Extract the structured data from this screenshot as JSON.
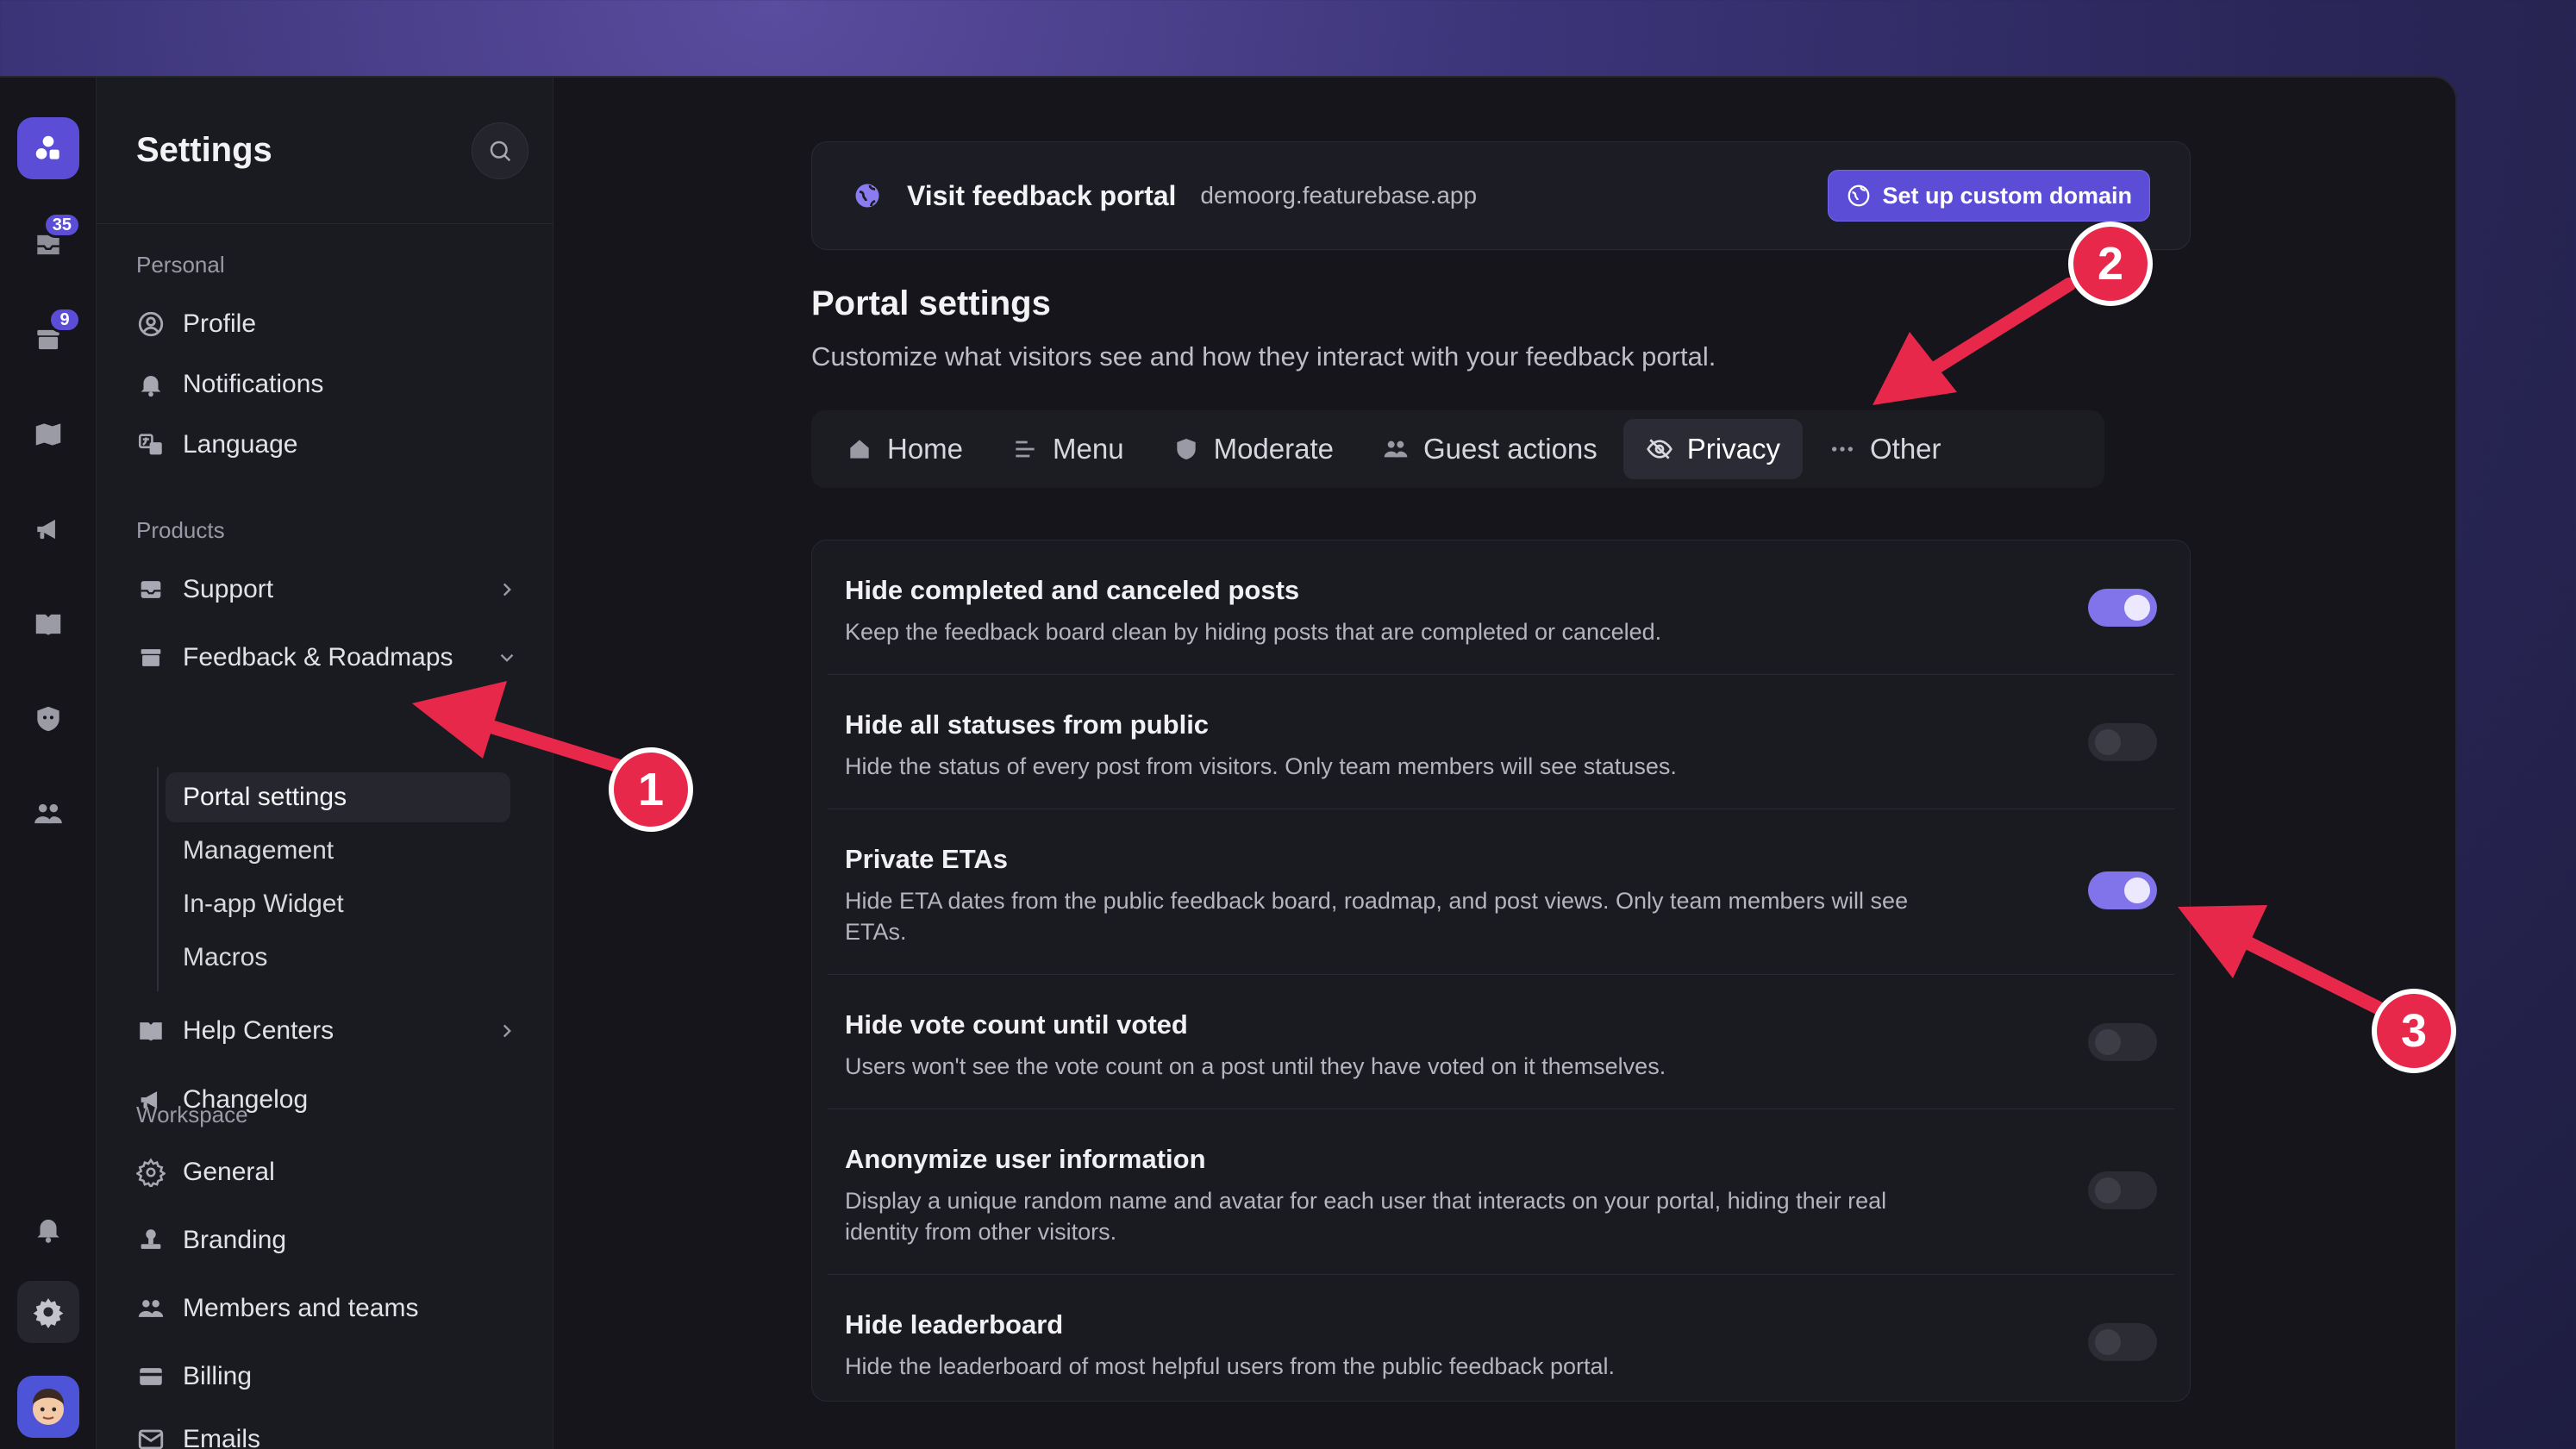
{
  "rail": {
    "badges": {
      "inbox": "35",
      "archive": "9"
    },
    "icons": [
      "logo-icon",
      "inbox-icon",
      "archive-icon",
      "map-icon",
      "megaphone-icon",
      "book-icon",
      "bot-icon",
      "users-icon",
      "bell-icon",
      "gear-icon",
      "avatar"
    ]
  },
  "sidebar": {
    "title": "Settings",
    "sections": {
      "personal": "Personal",
      "products": "Products",
      "workspace": "Workspace"
    },
    "items": {
      "profile": "Profile",
      "notifications": "Notifications",
      "language": "Language",
      "support": "Support",
      "feedback": "Feedback & Roadmaps",
      "help_centers": "Help Centers",
      "changelog": "Changelog",
      "general": "General",
      "branding": "Branding",
      "members": "Members and teams",
      "billing": "Billing",
      "emails": "Emails"
    },
    "feedback_sub": {
      "portal_settings": "Portal settings",
      "management": "Management",
      "widget": "In-app Widget",
      "macros": "Macros"
    }
  },
  "portal": {
    "title": "Visit feedback portal",
    "url": "demoorg.featurebase.app",
    "domain_button": "Set up custom domain"
  },
  "page": {
    "title": "Portal settings",
    "subtitle": "Customize what visitors see and how they interact with your feedback portal."
  },
  "tabs": {
    "home": "Home",
    "menu": "Menu",
    "moderate": "Moderate",
    "guest": "Guest actions",
    "privacy": "Privacy",
    "other": "Other",
    "active": "Privacy"
  },
  "settings": {
    "hide_completed": {
      "title": "Hide completed and canceled posts",
      "desc": "Keep the feedback board clean by hiding posts that are completed or canceled.",
      "on": true
    },
    "hide_statuses": {
      "title": "Hide all statuses from public",
      "desc": "Hide the status of every post from visitors. Only team members will see statuses.",
      "on": false
    },
    "private_etas": {
      "title": "Private ETAs",
      "desc": "Hide ETA dates from the public feedback board, roadmap, and post views. Only team members will see ETAs.",
      "on": true
    },
    "hide_votes": {
      "title": "Hide vote count until voted",
      "desc": "Users won't see the vote count on a post until they have voted on it themselves.",
      "on": false
    },
    "anonymize": {
      "title": "Anonymize user information",
      "desc": "Display a unique random name and avatar for each user that interacts on your portal, hiding their real identity from other visitors.",
      "on": false
    },
    "leaderboard": {
      "title": "Hide leaderboard",
      "desc": "Hide the leaderboard of most helpful users from the public feedback portal.",
      "on": false
    }
  },
  "annotations": {
    "one": "1",
    "two": "2",
    "three": "3"
  },
  "colors": {
    "accent": "#5b4dd6",
    "toggle_on": "#8174ea",
    "annotation": "#e8284a"
  }
}
